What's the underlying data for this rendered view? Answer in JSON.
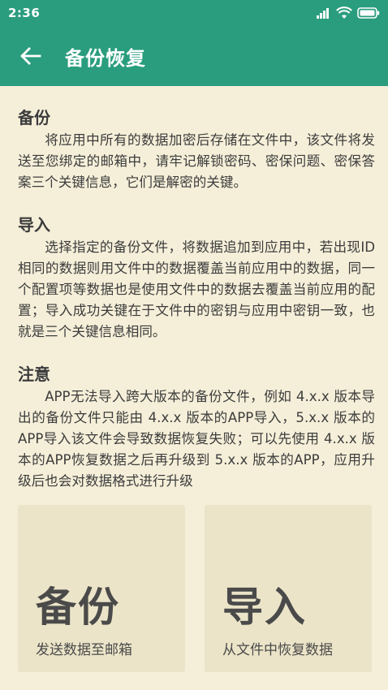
{
  "status": {
    "time": "2:36",
    "icons": [
      "signal-icon",
      "wifi-icon",
      "battery-icon"
    ]
  },
  "app_bar": {
    "title": "备份恢复",
    "back_icon": "arrow-left-icon"
  },
  "sections": [
    {
      "title": "备份",
      "body": "将应用中所有的数据加密后存储在文件中，该文件将发送至您绑定的邮箱中，请牢记解锁密码、密保问题、密保答案三个关键信息，它们是解密的关键。"
    },
    {
      "title": "导入",
      "body": "选择指定的备份文件，将数据追加到应用中，若出现ID相同的数据则用文件中的数据覆盖当前应用中的数据，同一个配置项等数据也是使用文件中的数据去覆盖当前应用的配置；导入成功关键在于文件中的密钥与应用中密钥一致，也就是三个关键信息相同。"
    },
    {
      "title": "注意",
      "body": "APP无法导入跨大版本的备份文件，例如 4.x.x 版本导出的备份文件只能由 4.x.x 版本的APP导入，5.x.x 版本的APP导入该文件会导致数据恢复失败；可以先使用 4.x.x 版本的APP恢复数据之后再升级到 5.x.x 版本的APP，应用升级后也会对数据格式进行升级"
    }
  ],
  "cards": {
    "backup": {
      "title": "备份",
      "subtitle": "发送数据至邮箱"
    },
    "import": {
      "title": "导入",
      "subtitle": "从文件中恢复数据"
    }
  },
  "colors": {
    "primary": "#2a9d7e",
    "background": "#f5efd9",
    "card": "#ebe4c8",
    "text": "#3c3c3c"
  }
}
